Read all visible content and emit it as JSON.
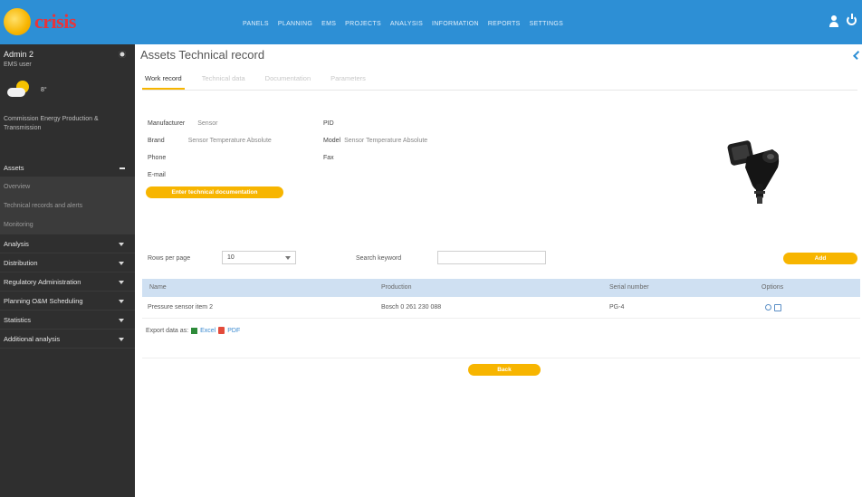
{
  "app": {
    "logo_text": "crisis",
    "logo_icon": "sun-logo-icon",
    "brand_color": "#2d8fd5",
    "accent_color": "#f7b500"
  },
  "topnav": [
    "PANELS",
    "PLANNING",
    "EMS",
    "PROJECTS",
    "ANALYSIS",
    "INFORMATION",
    "REPORTS",
    "SETTINGS"
  ],
  "user": {
    "name": "Admin 2",
    "role": "EMS user",
    "temperature": "8°",
    "location": "Commission Energy Production & Transmission"
  },
  "sidebar": {
    "items": [
      {
        "label": "Assets",
        "type": "open"
      },
      {
        "label": "Overview",
        "type": "sub"
      },
      {
        "label": "Technical records and alerts",
        "type": "sub"
      },
      {
        "label": "Monitoring",
        "type": "sub"
      },
      {
        "label": "Analysis",
        "type": "caret"
      },
      {
        "label": "Distribution",
        "type": "caret"
      },
      {
        "label": "Regulatory Administration",
        "type": "caret"
      },
      {
        "label": "Planning O&M Scheduling",
        "type": "caret"
      },
      {
        "label": "Statistics",
        "type": "caret"
      },
      {
        "label": "Additional analysis",
        "type": "caret"
      }
    ]
  },
  "page": {
    "title": "Assets Technical record"
  },
  "tabs": [
    "Work record",
    "Technical data",
    "Documentation",
    "Parameters"
  ],
  "record": {
    "manufacturer_label": "Manufacturer",
    "manufacturer_value": "Sensor",
    "pid_label": "PID",
    "pid_value": "",
    "brand_label": "Brand",
    "brand_value": "Sensor Temperature Absolute",
    "model_label": "Model",
    "model_value": "Sensor Temperature Absolute",
    "phone_label": "Phone",
    "phone_value": "",
    "fax_label": "Fax",
    "fax_value": "",
    "email_label": "E-mail",
    "email_value": "",
    "doc_button": "Enter technical documentation"
  },
  "controls": {
    "per_page_label": "Rows per page",
    "per_page_value": "10",
    "search_label": "Search keyword",
    "search_value": "",
    "add_button": "Add"
  },
  "table": {
    "headers": [
      "Name",
      "Production",
      "Serial number",
      "Options"
    ],
    "rows": [
      {
        "name": "Pressure sensor item 2",
        "production": "Bosch 0 261 230 088",
        "serial": "PG-4"
      }
    ]
  },
  "export": {
    "label": "Export data as:",
    "excel": "Excel",
    "pdf": "PDF"
  },
  "footer": {
    "back_button": "Back"
  }
}
